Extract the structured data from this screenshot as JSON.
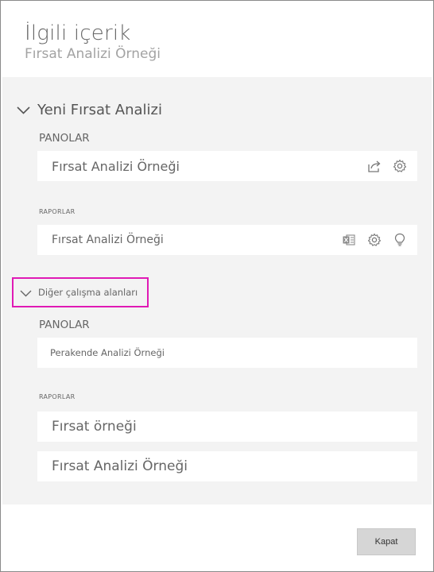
{
  "header": {
    "title": "İlgili içerik",
    "subtitle": "Fırsat Analizi Örneği"
  },
  "groups": [
    {
      "name": "Yeni Fırsat Analizi",
      "dashboards_label": "PANOLAR",
      "dashboards": [
        "Fırsat Analizi Örneği"
      ],
      "reports_label": "RAPORLAR",
      "reports": [
        "Fırsat Analizi Örneği"
      ]
    },
    {
      "name": "Diğer çalışma alanları",
      "dashboards_label": "PANOLAR",
      "dashboards": [
        "Perakende Analizi Örneği"
      ],
      "reports_label": "RAPORLAR",
      "reports": [
        "Fırsat örneği",
        "Fırsat Analizi Örneği"
      ]
    }
  ],
  "icons": {
    "share": "share-icon",
    "settings": "gear-icon",
    "excel": "excel-icon",
    "insights": "lightbulb-icon",
    "collapse": "chevron-down-icon"
  },
  "highlight_color": "#e01ab5",
  "footer": {
    "close_label": "Kapat"
  }
}
